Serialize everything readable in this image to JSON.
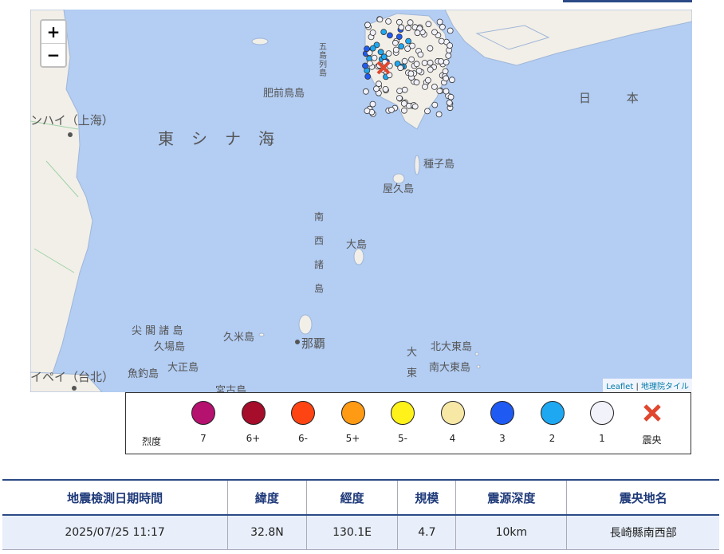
{
  "map": {
    "zoom_in": "+",
    "zoom_out": "−",
    "attribution": {
      "leaflet": "Leaflet",
      "sep": "|",
      "tiles": "地理院タイル"
    },
    "labels": {
      "east_china_sea": "東シナ海",
      "shanghai": "ンハイ（上海）",
      "taipei": "イペイ（台北）",
      "japan": "日 本",
      "hizen": "肥前鳥島",
      "goto": "五島列島",
      "tanegashima": "種子島",
      "yakushima": "屋久島",
      "nansei": "南西諸島",
      "oshima": "大島",
      "senkaku": "尖 閣 諸 島",
      "kubajima": "久場島",
      "kumejima": "久米島",
      "naha": "那覇",
      "uotsuri": "魚釣島",
      "taisho": "大正島",
      "miyako": "宮古島",
      "daito": "大東",
      "kitadaito": "北大東島",
      "minamidaito": "南大東島"
    },
    "epicenter_color": "#e0472e"
  },
  "legend": {
    "title": "烈度",
    "items": [
      {
        "label": "7",
        "color": "#b5116f"
      },
      {
        "label": "6+",
        "color": "#a50d2a"
      },
      {
        "label": "6-",
        "color": "#ff4414"
      },
      {
        "label": "5+",
        "color": "#ff9a14"
      },
      {
        "label": "5-",
        "color": "#fff21a"
      },
      {
        "label": "4",
        "color": "#f7e8a6"
      },
      {
        "label": "3",
        "color": "#1f5bf2"
      },
      {
        "label": "2",
        "color": "#1fa8f2"
      },
      {
        "label": "1",
        "color": "#f2f2fb"
      },
      {
        "label": "震央",
        "color": "#e0472e"
      }
    ]
  },
  "table": {
    "headers": [
      "地震檢測日期時間",
      "緯度",
      "經度",
      "規模",
      "震源深度",
      "震央地名"
    ],
    "row": [
      "2025/07/25 11:17",
      "32.8N",
      "130.1E",
      "4.7",
      "10km",
      "長崎縣南西部"
    ]
  }
}
